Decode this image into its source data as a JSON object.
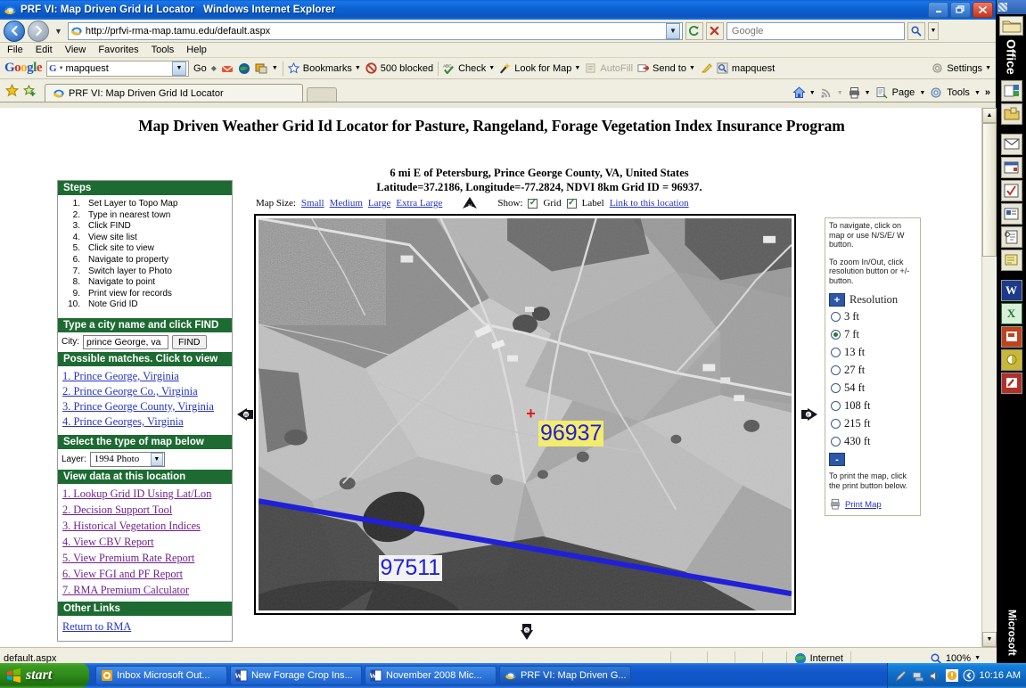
{
  "window": {
    "title": "PRF VI: Map Driven Grid Id Locator",
    "app": "Windows Internet Explorer",
    "minimize": "_",
    "maximize": "□",
    "close": "×"
  },
  "address": {
    "url": "http://prfvi-rma-map.tamu.edu/default.aspx",
    "search_placeholder": "Google",
    "refresh_icon": "refresh-icon",
    "stop_icon": "stop-icon",
    "search_icon": "search-icon"
  },
  "menubar": [
    "File",
    "Edit",
    "View",
    "Favorites",
    "Tools",
    "Help"
  ],
  "google_toolbar": {
    "logo": "Google",
    "query": "mapquest",
    "go": "Go",
    "items": [
      {
        "label": "Bookmarks",
        "icon": "star-icon",
        "caret": true
      },
      {
        "label": "500 blocked",
        "icon": "blocked-icon",
        "caret": false
      },
      {
        "label": "Check",
        "icon": "spellcheck-icon",
        "caret": true
      },
      {
        "label": "Look for Map",
        "icon": "wand-icon",
        "caret": true
      },
      {
        "label": "AutoFill",
        "icon": "autofill-icon",
        "caret": false,
        "dim": true
      },
      {
        "label": "Send to",
        "icon": "sendto-icon",
        "caret": true
      },
      {
        "label": "",
        "icon": "highlight-icon",
        "caret": false
      },
      {
        "label": "mapquest",
        "icon": "find-icon",
        "caret": false
      }
    ],
    "settings": "Settings"
  },
  "tabs": {
    "active_tab": "PRF VI: Map Driven Grid Id Locator",
    "tools_items": [
      {
        "label": "",
        "icon": "home-icon",
        "caret": true
      },
      {
        "label": "",
        "icon": "feed-icon",
        "caret": true
      },
      {
        "label": "",
        "icon": "print-icon",
        "caret": true
      },
      {
        "label": "Page",
        "icon": "page-icon",
        "caret": true
      },
      {
        "label": "Tools",
        "icon": "gear-icon",
        "caret": true
      }
    ],
    "overflow": "»"
  },
  "page": {
    "title": "Map Driven Weather Grid Id Locator for Pasture, Rangeland, Forage Vegetation Index Insurance Program",
    "sidebar": {
      "steps_header": "Steps",
      "steps": [
        {
          "num": "1.",
          "text": "Set Layer to Topo Map"
        },
        {
          "num": "2.",
          "text": "Type in nearest town"
        },
        {
          "num": "3.",
          "text": "Click FIND"
        },
        {
          "num": "4.",
          "text": "View site list"
        },
        {
          "num": "5.",
          "text": "Click site to view"
        },
        {
          "num": "6.",
          "text": "Navigate to property"
        },
        {
          "num": "7.",
          "text": "Switch layer to Photo"
        },
        {
          "num": "8.",
          "text": "Navigate to point"
        },
        {
          "num": "9.",
          "text": "Print view for records"
        },
        {
          "num": "10.",
          "text": "Note Grid ID"
        }
      ],
      "find_header": "Type a city name and click FIND",
      "city_label": "City:",
      "city_value": "prince George, va",
      "city_placeholder": "",
      "find_button": "FIND",
      "matches_header": "Possible matches. Click to view",
      "matches": [
        "1. Prince George, Virginia",
        "2. Prince George Co., Virginia",
        "3. Prince George County, Virginia",
        "4. Prince Georges, Virginia"
      ],
      "maptype_header": "Select the type of map below",
      "layer_label": "Layer:",
      "layer_value": "1994 Photo",
      "viewdata_header": "View data at this location",
      "datalinks": [
        "1. Lookup Grid ID Using Lat/Lon",
        "2. Decision Support Tool",
        "3. Historical Vegetation Indices",
        "4. View CBV Report",
        "5. View Premium Rate Report",
        "6. View FGI and PF Report",
        "7. RMA Premium Calculator"
      ],
      "otherlinks_header": "Other Links",
      "otherlinks": [
        "Return to RMA"
      ]
    },
    "map": {
      "location_line1": "6 mi E of Petersburg, Prince George County, VA, United States",
      "location_line2": "Latitude=37.2186, Longitude=-77.2824, NDVI 8km Grid ID = 96937.",
      "mapsize_label": "Map Size:",
      "mapsize_options": [
        "Small",
        "Medium",
        "Large",
        "Extra Large"
      ],
      "north_icon": "north-arrow-icon",
      "show_label": "Show:",
      "show_grid": "Grid",
      "show_label_cb": "Label",
      "grid_checked": "✓",
      "label_checked": "✓",
      "link_text": "Link to this location",
      "grid_labels": [
        {
          "id": "96937",
          "highlight": true
        },
        {
          "id": "97511",
          "highlight": false
        }
      ],
      "nav_west": "W",
      "nav_east": "E",
      "nav_south": "S"
    },
    "navpanel": {
      "help1": "To navigate, click on map or use N/S/E/ W button.",
      "help2": "To zoom In/Out, click resolution button or +/- button.",
      "plus": "+",
      "minus": "-",
      "resolution_title": "Resolution",
      "resolutions": [
        {
          "label": "3 ft",
          "selected": false
        },
        {
          "label": "7 ft",
          "selected": true
        },
        {
          "label": "13 ft",
          "selected": false
        },
        {
          "label": "27 ft",
          "selected": false
        },
        {
          "label": "54 ft",
          "selected": false
        },
        {
          "label": "108 ft",
          "selected": false
        },
        {
          "label": "215 ft",
          "selected": false
        },
        {
          "label": "430 ft",
          "selected": false
        }
      ],
      "print_help": "To print the map, click the print button below.",
      "print_link": "Print Map"
    }
  },
  "statusbar": {
    "page_name": "default.aspx",
    "zone": "Internet",
    "zone_icon": "globe-icon",
    "zoom": "100%",
    "zoom_icon": "zoom-icon"
  },
  "officebar": {
    "label": "Office",
    "brand": "Microsoft",
    "buttons": [
      "new-office-document-icon",
      "open-office-document-icon",
      "new-mail-message-icon",
      "new-appointment-icon",
      "new-task-icon",
      "new-contact-icon",
      "new-journal-entry-icon",
      "new-note-icon",
      "word-icon",
      "excel-icon",
      "powerpoint-icon",
      "access-icon",
      "publisher-icon"
    ]
  },
  "taskbar": {
    "start": "start",
    "tasks": [
      {
        "label": "Inbox  Microsoft Out...",
        "icon": "outlook-icon",
        "active": false
      },
      {
        "label": "New Forage Crop Ins...",
        "icon": "word-icon",
        "active": false
      },
      {
        "label": "November 2008  Mic...",
        "icon": "word-icon",
        "active": false
      },
      {
        "label": "PRF VI: Map Driven G...",
        "icon": "ie-icon",
        "active": true
      }
    ],
    "tray_icons": [
      "pen-icon",
      "network-icon",
      "volume-icon",
      "updates-icon",
      "show-desktop-icon"
    ],
    "clock": "10:16 AM"
  }
}
